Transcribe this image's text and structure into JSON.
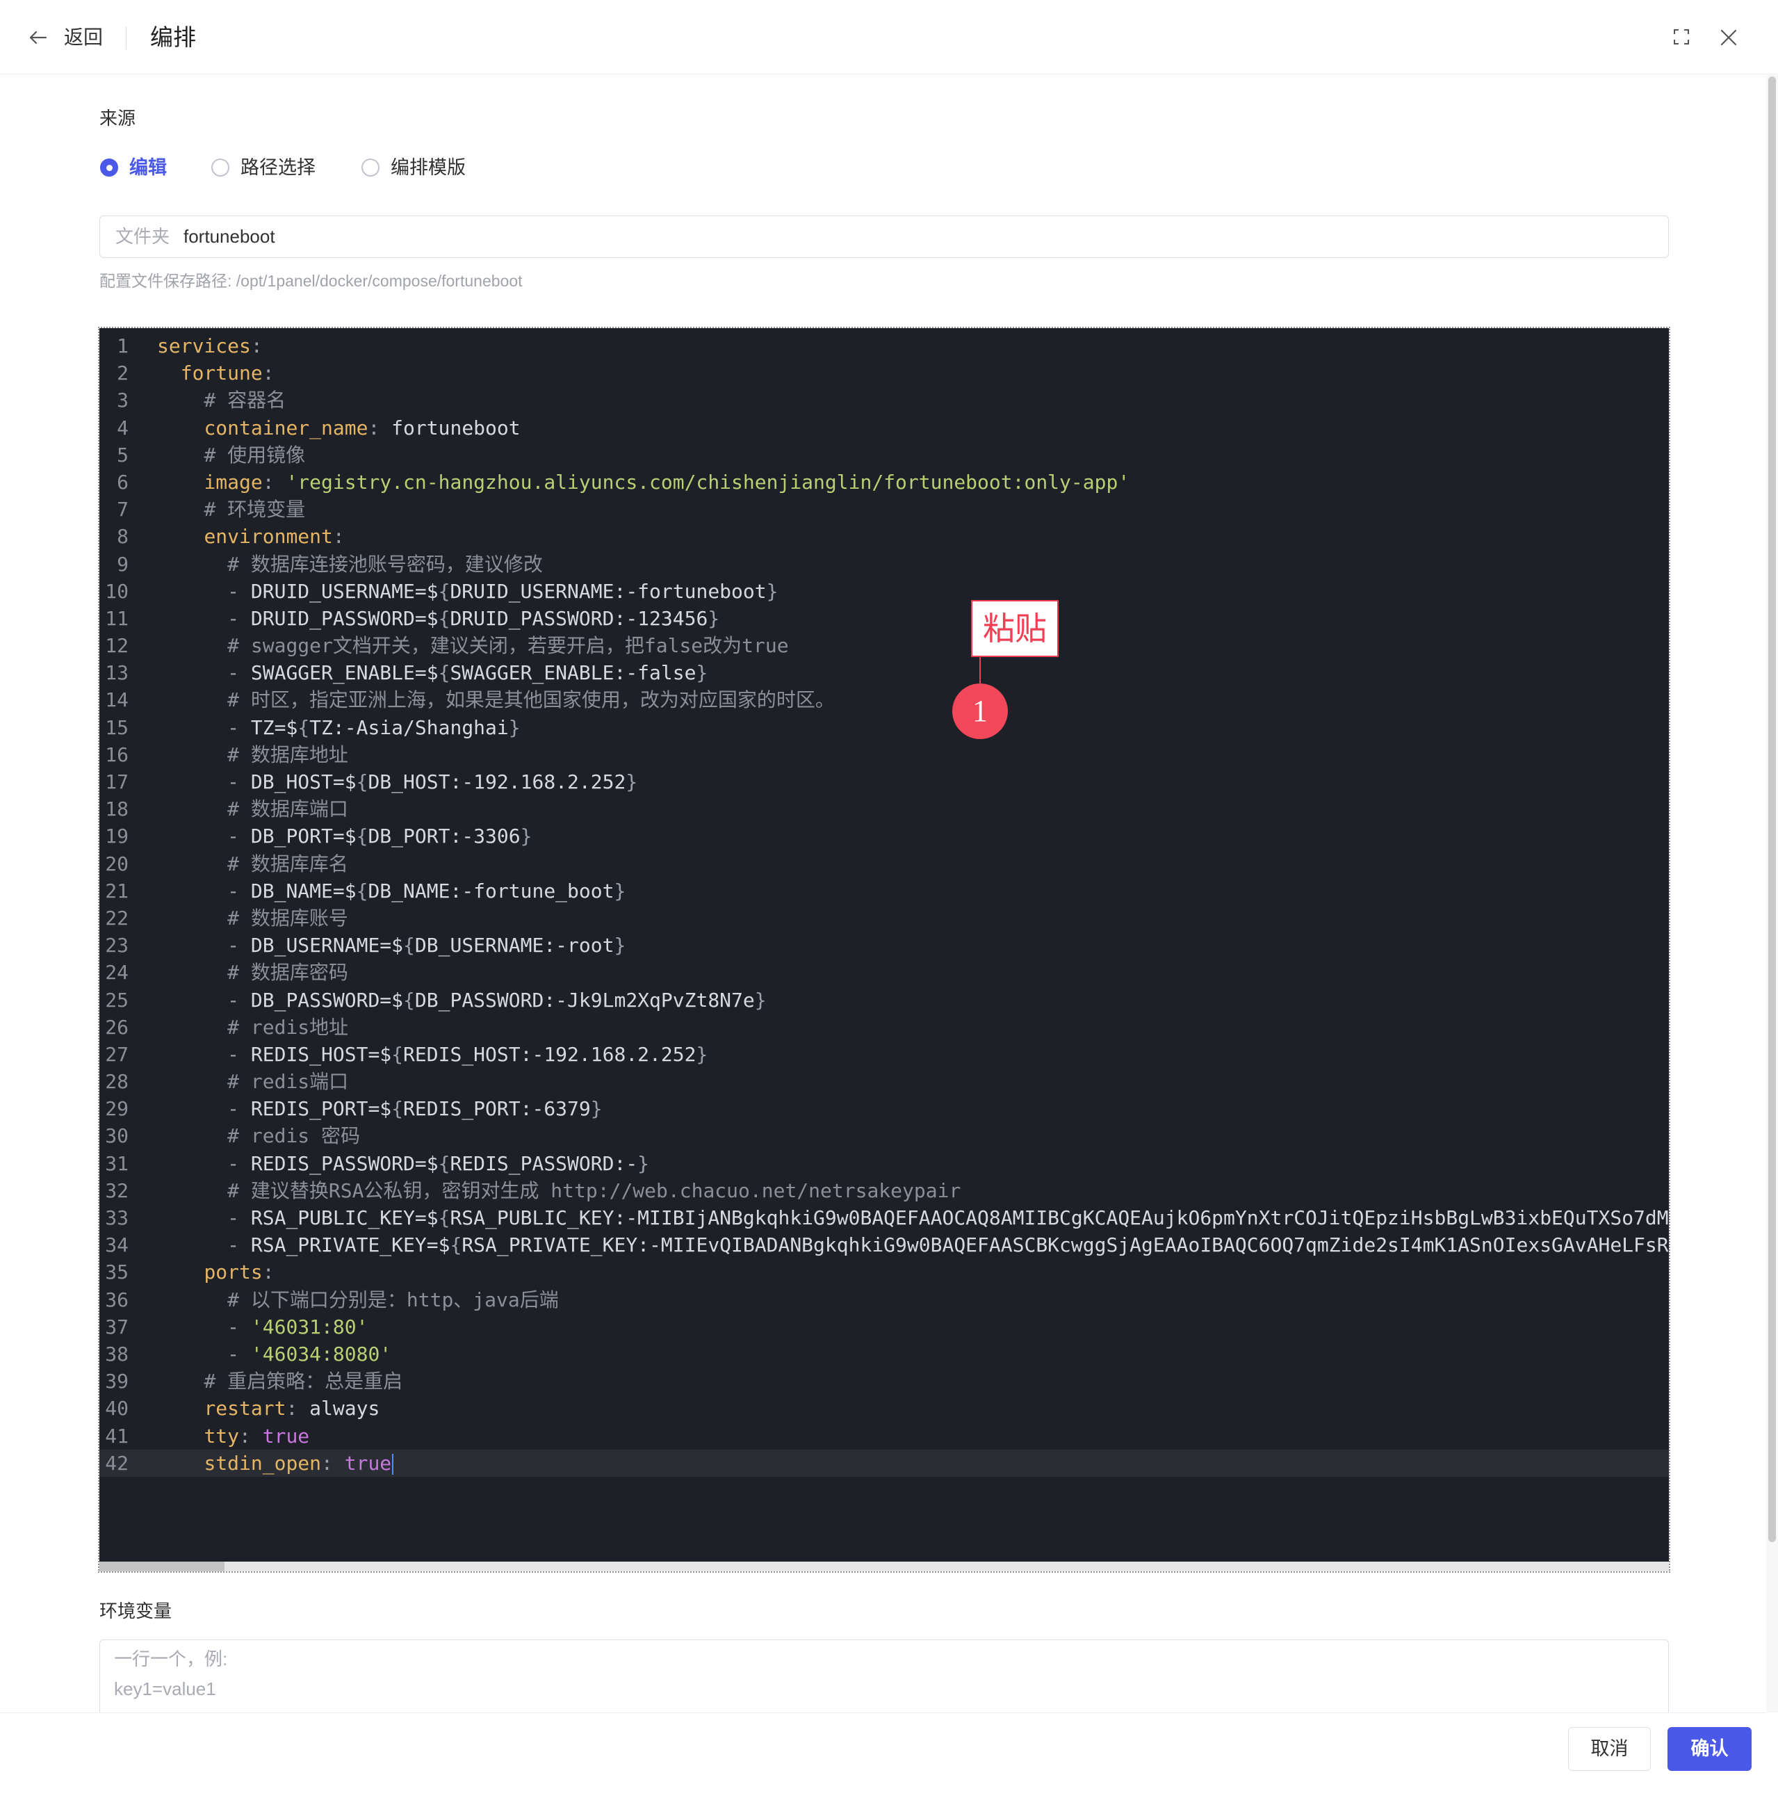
{
  "header": {
    "back_label": "返回",
    "title": "编排",
    "icons": [
      "arrow-left-icon",
      "fullscreen-icon",
      "close-icon"
    ]
  },
  "source": {
    "label": "来源",
    "options": [
      {
        "label": "编辑",
        "selected": true
      },
      {
        "label": "路径选择",
        "selected": false
      },
      {
        "label": "编排模版",
        "selected": false
      }
    ]
  },
  "folder": {
    "prefix": "文件夹",
    "value": "fortuneboot"
  },
  "path_hint": "配置文件保存路径: /opt/1panel/docker/compose/fortuneboot",
  "editor": {
    "active_line": 42,
    "lines": [
      "services:",
      "  fortune:",
      "    # 容器名",
      "    container_name: fortuneboot",
      "    # 使用镜像",
      "    image: 'registry.cn-hangzhou.aliyuncs.com/chishenjianglin/fortuneboot:only-app'",
      "    # 环境变量",
      "    environment:",
      "      # 数据库连接池账号密码，建议修改",
      "      - DRUID_USERNAME=${DRUID_USERNAME:-fortuneboot}",
      "      - DRUID_PASSWORD=${DRUID_PASSWORD:-123456}",
      "      # swagger文档开关，建议关闭，若要开启，把false改为true",
      "      - SWAGGER_ENABLE=${SWAGGER_ENABLE:-false}",
      "      # 时区，指定亚洲上海，如果是其他国家使用，改为对应国家的时区。",
      "      - TZ=${TZ:-Asia/Shanghai}",
      "      # 数据库地址",
      "      - DB_HOST=${DB_HOST:-192.168.2.252}",
      "      # 数据库端口",
      "      - DB_PORT=${DB_PORT:-3306}",
      "      # 数据库库名",
      "      - DB_NAME=${DB_NAME:-fortune_boot}",
      "      # 数据库账号",
      "      - DB_USERNAME=${DB_USERNAME:-root}",
      "      # 数据库密码",
      "      - DB_PASSWORD=${DB_PASSWORD:-Jk9Lm2XqPvZt8N7e}",
      "      # redis地址",
      "      - REDIS_HOST=${REDIS_HOST:-192.168.2.252}",
      "      # redis端口",
      "      - REDIS_PORT=${REDIS_PORT:-6379}",
      "      # redis 密码",
      "      - REDIS_PASSWORD=${REDIS_PASSWORD:-}",
      "      # 建议替换RSA公私钥，密钥对生成 http://web.chacuo.net/netrsakeypair",
      "      - RSA_PUBLIC_KEY=${RSA_PUBLIC_KEY:-MIIBIjANBgkqhkiG9w0BAQEFAAOCAQ8AMIIBCgKCAQEAujkO6pmYnXtrCOJitQEpziHsbBgLwB3ixbEQuTXSo7dM",
      "      - RSA_PRIVATE_KEY=${RSA_PRIVATE_KEY:-MIIEvQIBADANBgkqhkiG9w0BAQEFAASCBKcwggSjAgEAAoIBAQC6OQ7qmZide2sI4mK1ASnOIexsGAvAHeLFsR",
      "    ports:",
      "      # 以下端口分别是：http、java后端",
      "      - '46031:80'",
      "      - '46034:8080'",
      "    # 重启策略：总是重启",
      "    restart: always",
      "    tty: true",
      "    stdin_open: true"
    ]
  },
  "annotation": {
    "label": "粘贴",
    "step": "1"
  },
  "env": {
    "label": "环境变量",
    "placeholder": "一行一个，例:\nkey1=value1"
  },
  "footer": {
    "cancel_label": "取消",
    "confirm_label": "确认"
  },
  "colors": {
    "accent": "#4b59e8",
    "annotation": "#ef3f55",
    "editor_bg": "#1e2027"
  }
}
